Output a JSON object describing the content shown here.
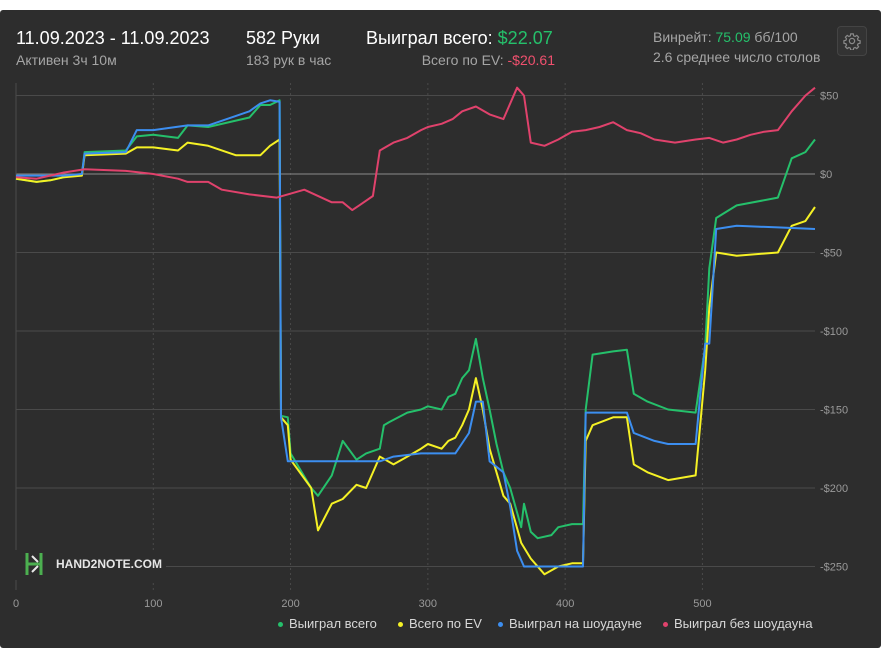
{
  "header": {
    "date_range": "11.09.2023 - 11.09.2023",
    "active": "Активен 3ч 10м",
    "hands": "582 Руки",
    "hands_per_hour": "183 рук в час",
    "won_total_label": "Выиграл всего:",
    "won_total_value": "$22.07",
    "ev_total_label": "Всего по EV:",
    "ev_total_value": "-$20.61",
    "winrate_label": "Винрейт:",
    "winrate_value": "75.09",
    "winrate_unit": "бб/100",
    "avg_tables": "2.6 среднее число столов"
  },
  "watermark": {
    "logo_text": "HAND2NOTE.COM"
  },
  "colors": {
    "won": "#25c06b",
    "ev": "#f5f125",
    "showdown": "#3c8ef0",
    "non_showdown": "#e0426c",
    "grid": "#4a4a4a",
    "zero": "#8a8a8a"
  },
  "chart_data": {
    "type": "line",
    "xlim": [
      0,
      582
    ],
    "ylim": [
      -265,
      58
    ],
    "x_ticks": [
      0,
      100,
      200,
      300,
      400,
      500
    ],
    "x_tick_labels": [
      "0",
      "100",
      "200",
      "300",
      "400",
      "500"
    ],
    "y_ticks": [
      50,
      0,
      -50,
      -100,
      -150,
      -200,
      -250
    ],
    "y_tick_labels": [
      "$50",
      "$0",
      "-$50",
      "-$100",
      "-$150",
      "-$200",
      "-$250"
    ],
    "grid": true,
    "legend_position": "bottom-right",
    "series": [
      {
        "name": "Выиграл всего",
        "points": [
          [
            0,
            -3
          ],
          [
            15,
            -5
          ],
          [
            25,
            -4
          ],
          [
            35,
            -2
          ],
          [
            48,
            0
          ],
          [
            50,
            14
          ],
          [
            80,
            15
          ],
          [
            88,
            24
          ],
          [
            100,
            25
          ],
          [
            118,
            23
          ],
          [
            125,
            31
          ],
          [
            140,
            30
          ],
          [
            170,
            36
          ],
          [
            178,
            44
          ],
          [
            185,
            44
          ],
          [
            192,
            47
          ],
          [
            193,
            -154
          ],
          [
            198,
            -155
          ],
          [
            200,
            -178
          ],
          [
            215,
            -200
          ],
          [
            220,
            -205
          ],
          [
            230,
            -192
          ],
          [
            238,
            -170
          ],
          [
            248,
            -182
          ],
          [
            255,
            -178
          ],
          [
            265,
            -175
          ],
          [
            268,
            -160
          ],
          [
            272,
            -158
          ],
          [
            285,
            -152
          ],
          [
            295,
            -150
          ],
          [
            300,
            -148
          ],
          [
            310,
            -150
          ],
          [
            315,
            -142
          ],
          [
            320,
            -140
          ],
          [
            325,
            -130
          ],
          [
            330,
            -125
          ],
          [
            335,
            -105
          ],
          [
            340,
            -130
          ],
          [
            345,
            -150
          ],
          [
            350,
            -172
          ],
          [
            355,
            -190
          ],
          [
            360,
            -200
          ],
          [
            368,
            -225
          ],
          [
            370,
            -210
          ],
          [
            375,
            -228
          ],
          [
            380,
            -232
          ],
          [
            390,
            -230
          ],
          [
            395,
            -225
          ],
          [
            405,
            -223
          ],
          [
            413,
            -223
          ],
          [
            415,
            -150
          ],
          [
            420,
            -115
          ],
          [
            435,
            -113
          ],
          [
            445,
            -112
          ],
          [
            450,
            -140
          ],
          [
            460,
            -145
          ],
          [
            475,
            -150
          ],
          [
            495,
            -152
          ],
          [
            502,
            -110
          ],
          [
            505,
            -60
          ],
          [
            510,
            -28
          ],
          [
            525,
            -20
          ],
          [
            555,
            -15
          ],
          [
            565,
            10
          ],
          [
            575,
            14
          ],
          [
            582,
            22
          ]
        ]
      },
      {
        "name": "Всего по EV",
        "points": [
          [
            0,
            -3
          ],
          [
            15,
            -5
          ],
          [
            25,
            -4
          ],
          [
            35,
            -2
          ],
          [
            48,
            -1
          ],
          [
            50,
            12
          ],
          [
            80,
            13
          ],
          [
            88,
            17
          ],
          [
            100,
            17
          ],
          [
            118,
            15
          ],
          [
            125,
            20
          ],
          [
            140,
            18
          ],
          [
            160,
            12
          ],
          [
            178,
            12
          ],
          [
            185,
            18
          ],
          [
            192,
            22
          ],
          [
            193,
            -155
          ],
          [
            198,
            -160
          ],
          [
            200,
            -182
          ],
          [
            215,
            -200
          ],
          [
            220,
            -227
          ],
          [
            230,
            -210
          ],
          [
            238,
            -207
          ],
          [
            248,
            -198
          ],
          [
            255,
            -200
          ],
          [
            265,
            -180
          ],
          [
            275,
            -185
          ],
          [
            285,
            -180
          ],
          [
            295,
            -175
          ],
          [
            300,
            -172
          ],
          [
            310,
            -175
          ],
          [
            315,
            -170
          ],
          [
            320,
            -168
          ],
          [
            325,
            -160
          ],
          [
            330,
            -150
          ],
          [
            335,
            -130
          ],
          [
            340,
            -150
          ],
          [
            345,
            -175
          ],
          [
            350,
            -190
          ],
          [
            355,
            -205
          ],
          [
            360,
            -210
          ],
          [
            368,
            -235
          ],
          [
            375,
            -245
          ],
          [
            385,
            -255
          ],
          [
            395,
            -250
          ],
          [
            405,
            -248
          ],
          [
            413,
            -248
          ],
          [
            415,
            -170
          ],
          [
            420,
            -160
          ],
          [
            435,
            -155
          ],
          [
            445,
            -155
          ],
          [
            450,
            -185
          ],
          [
            460,
            -190
          ],
          [
            475,
            -195
          ],
          [
            495,
            -192
          ],
          [
            502,
            -125
          ],
          [
            505,
            -85
          ],
          [
            510,
            -50
          ],
          [
            525,
            -52
          ],
          [
            555,
            -50
          ],
          [
            565,
            -33
          ],
          [
            575,
            -30
          ],
          [
            582,
            -21
          ]
        ]
      },
      {
        "name": "Выиграл на шоудауне",
        "points": [
          [
            0,
            -1
          ],
          [
            15,
            -1
          ],
          [
            35,
            -1
          ],
          [
            48,
            0
          ],
          [
            50,
            13
          ],
          [
            80,
            14
          ],
          [
            88,
            28
          ],
          [
            100,
            28
          ],
          [
            125,
            31
          ],
          [
            140,
            31
          ],
          [
            170,
            40
          ],
          [
            178,
            45
          ],
          [
            185,
            47
          ],
          [
            192,
            46
          ],
          [
            193,
            -155
          ],
          [
            198,
            -183
          ],
          [
            210,
            -183
          ],
          [
            255,
            -183
          ],
          [
            265,
            -183
          ],
          [
            275,
            -180
          ],
          [
            295,
            -178
          ],
          [
            300,
            -178
          ],
          [
            320,
            -178
          ],
          [
            330,
            -165
          ],
          [
            335,
            -145
          ],
          [
            340,
            -145
          ],
          [
            345,
            -183
          ],
          [
            355,
            -190
          ],
          [
            360,
            -212
          ],
          [
            365,
            -240
          ],
          [
            370,
            -250
          ],
          [
            380,
            -250
          ],
          [
            390,
            -250
          ],
          [
            400,
            -250
          ],
          [
            413,
            -250
          ],
          [
            415,
            -152
          ],
          [
            445,
            -152
          ],
          [
            450,
            -165
          ],
          [
            465,
            -170
          ],
          [
            475,
            -172
          ],
          [
            495,
            -172
          ],
          [
            502,
            -108
          ],
          [
            505,
            -108
          ],
          [
            510,
            -35
          ],
          [
            525,
            -33
          ],
          [
            555,
            -34
          ],
          [
            582,
            -35
          ]
        ]
      },
      {
        "name": "Выиграл без шоудауна",
        "points": [
          [
            0,
            -2
          ],
          [
            15,
            -3
          ],
          [
            35,
            1
          ],
          [
            50,
            3
          ],
          [
            80,
            2
          ],
          [
            100,
            0
          ],
          [
            118,
            -3
          ],
          [
            125,
            -5
          ],
          [
            140,
            -5
          ],
          [
            150,
            -10
          ],
          [
            170,
            -13
          ],
          [
            190,
            -15
          ],
          [
            210,
            -10
          ],
          [
            230,
            -18
          ],
          [
            238,
            -18
          ],
          [
            245,
            -23
          ],
          [
            250,
            -20
          ],
          [
            255,
            -17
          ],
          [
            260,
            -14
          ],
          [
            265,
            15
          ],
          [
            275,
            20
          ],
          [
            285,
            23
          ],
          [
            295,
            28
          ],
          [
            300,
            30
          ],
          [
            310,
            32
          ],
          [
            318,
            35
          ],
          [
            325,
            40
          ],
          [
            335,
            43
          ],
          [
            345,
            38
          ],
          [
            355,
            35
          ],
          [
            365,
            55
          ],
          [
            370,
            50
          ],
          [
            375,
            20
          ],
          [
            385,
            18
          ],
          [
            395,
            22
          ],
          [
            405,
            27
          ],
          [
            415,
            28
          ],
          [
            425,
            30
          ],
          [
            435,
            33
          ],
          [
            445,
            28
          ],
          [
            455,
            26
          ],
          [
            465,
            22
          ],
          [
            480,
            20
          ],
          [
            495,
            22
          ],
          [
            505,
            23
          ],
          [
            515,
            20
          ],
          [
            525,
            22
          ],
          [
            535,
            25
          ],
          [
            545,
            27
          ],
          [
            555,
            28
          ],
          [
            565,
            40
          ],
          [
            575,
            50
          ],
          [
            582,
            55
          ]
        ]
      }
    ]
  }
}
